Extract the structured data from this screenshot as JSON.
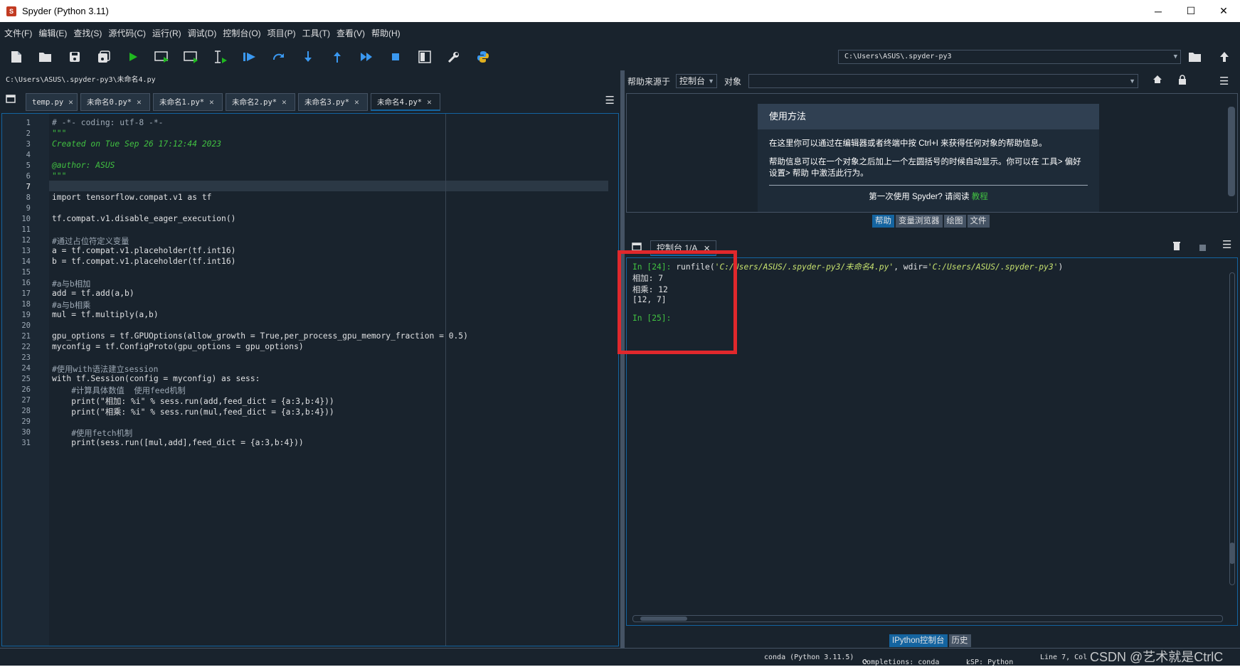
{
  "window": {
    "title": "Spyder (Python 3.11)",
    "minimize": "─",
    "maximize": "☐",
    "close": "✕",
    "app_icon": "spyder-icon"
  },
  "menu": [
    "文件(F)",
    "编辑(E)",
    "查找(S)",
    "源代码(C)",
    "运行(R)",
    "调试(D)",
    "控制台(O)",
    "项目(P)",
    "工具(T)",
    "查看(V)",
    "帮助(H)"
  ],
  "toolbar": {
    "icons": [
      "new-file-icon",
      "open-file-icon",
      "save-icon",
      "save-all-icon",
      "run-icon",
      "run-cell-icon",
      "run-cell-advance-icon",
      "run-selection-icon",
      "debug-icon",
      "step-over-icon",
      "step-into-icon",
      "step-return-icon",
      "continue-icon",
      "stop-icon",
      "maximize-pane-icon",
      "preferences-icon",
      "python-path-icon"
    ],
    "working_dir": "C:\\Users\\ASUS\\.spyder-py3"
  },
  "editor": {
    "file_path": "C:\\Users\\ASUS\\.spyder-py3\\未命名4.py",
    "tabs": [
      {
        "label": "temp.py",
        "active": false
      },
      {
        "label": "未命名0.py*",
        "active": false
      },
      {
        "label": "未命名1.py*",
        "active": false
      },
      {
        "label": "未命名2.py*",
        "active": false
      },
      {
        "label": "未命名3.py*",
        "active": false
      },
      {
        "label": "未命名4.py*",
        "active": true
      }
    ],
    "line_numbers": [
      "1",
      "2",
      "3",
      "4",
      "5",
      "6",
      "7",
      "8",
      "9",
      "10",
      "11",
      "12",
      "13",
      "14",
      "15",
      "16",
      "17",
      "18",
      "19",
      "20",
      "21",
      "22",
      "23",
      "24",
      "25",
      "26",
      "27",
      "28",
      "29",
      "30",
      "31"
    ],
    "code": [
      "# -*- coding: utf-8 -*-",
      "\"\"\"",
      "Created on Tue Sep 26 17:12:44 2023",
      "",
      "@author: ASUS",
      "\"\"\"",
      "",
      "import tensorflow.compat.v1 as tf",
      "",
      "tf.compat.v1.disable_eager_execution()",
      "",
      "#通过占位符定义变量",
      "a = tf.compat.v1.placeholder(tf.int16)",
      "b = tf.compat.v1.placeholder(tf.int16)",
      "",
      "#a与b相加",
      "add = tf.add(a,b)",
      "#a与b相乘",
      "mul = tf.multiply(a,b)",
      "",
      "gpu_options = tf.GPUOptions(allow_growth = True,per_process_gpu_memory_fraction = 0.5)",
      "myconfig = tf.ConfigProto(gpu_options = gpu_options)",
      "",
      "#使用with语法建立session",
      "with tf.Session(config = myconfig) as sess:",
      "    #计算具体数值  使用feed机制",
      "    print(\"相加: %i\" % sess.run(add,feed_dict = {a:3,b:4}))",
      "    print(\"相乘: %i\" % sess.run(mul,feed_dict = {a:3,b:4}))",
      "",
      "    #使用fetch机制",
      "    print(sess.run([mul,add],feed_dict = {a:3,b:4}))"
    ]
  },
  "help": {
    "source_label": "帮助来源于",
    "source_value": "控制台",
    "object_label": "对象",
    "object_value": "",
    "card_title": "使用方法",
    "para1": "在这里你可以通过在编辑器或者终端中按 Ctrl+I 来获得任何对象的帮助信息。",
    "para2": "帮助信息可以在一个对象之后加上一个左圆括号的时候自动显示。你可以在 工具> 偏好设置> 帮助 中激活此行为。",
    "first_time": "第一次使用 Spyder? 请阅读",
    "tutorial_link": "教程",
    "tabs": [
      "帮助",
      "变量浏览器",
      "绘图",
      "文件"
    ]
  },
  "console": {
    "tab_label": "控制台 1/A",
    "in24_prompt": "In [24]:",
    "in24_cmd_prefix": " runfile(",
    "in24_path": "'C:/Users/ASUS/.spyder-py3/未命名4.py'",
    "in24_mid": ", wdir=",
    "in24_wdir": "'C:/Users/ASUS/.spyder-py3'",
    "in24_end": ")",
    "out_lines": [
      "相加: 7",
      "相乘: 12",
      "[12, 7]"
    ],
    "in25_prompt": "In [25]:",
    "tabs": [
      "IPython控制台",
      "历史"
    ]
  },
  "statusbar": {
    "env": "conda (Python 3.11.5)",
    "completions": "Completions: conda",
    "lsp": "LSP: Python",
    "position": "Line 7, Col"
  },
  "watermark": "CSDN @艺术就是CtrlC",
  "colors": {
    "background": "#19232d",
    "accent": "#1464a0",
    "highlight": "#e0282c",
    "prompt": "#41c141"
  }
}
